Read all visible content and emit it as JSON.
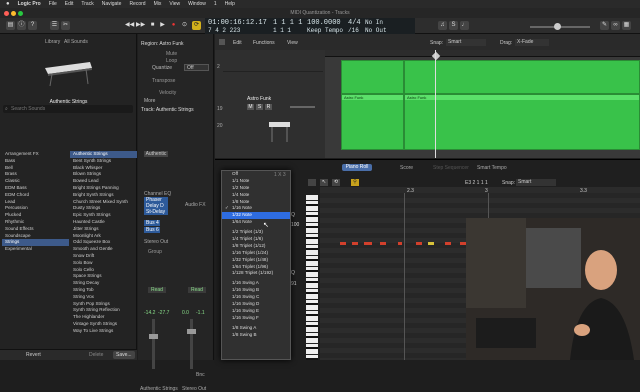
{
  "menubar": {
    "app": "Logic Pro",
    "items": [
      "File",
      "Edit",
      "Track",
      "Navigate",
      "Record",
      "Mix",
      "View",
      "Window",
      "1",
      "Help"
    ]
  },
  "window": {
    "title": "MIDI Quantization - Tracks"
  },
  "lcd": {
    "time": "01:00:16:12.17",
    "time_sub": "7 4 2 223",
    "bars": "1  1  1  1",
    "bars_sub": "1  1  1",
    "tempo": "100.0000",
    "tempo_sub": "Keep Tempo",
    "sig": "4/4",
    "sig_sub": "/16",
    "in": "No In",
    "out": "No Out"
  },
  "library": {
    "title": "Library",
    "presets": "All Sounds",
    "patch": "Authentic Strings",
    "search_placeholder": "Search Sounds",
    "categories": [
      "Arrangement FX",
      "Bass",
      "Bell",
      "Brass",
      "Classic",
      "EDM Bass",
      "EDM Chord",
      "Lead",
      "Percussion",
      "Plucked",
      "Rhythmic",
      "Sound Effects",
      "Soundscape",
      "Strings",
      "Experimental"
    ],
    "patches": [
      "Authentic Strings",
      "Bent Synth Strings",
      "Black Whisper",
      "Blown Strings",
      "Bowed Lead",
      "Bright Strings Panning",
      "Bright Synth Strings",
      "Church Street Mixed Synth",
      "Dusty Strings",
      "Epic Synth Strings",
      "Haunted Castle",
      "Jitter Strings",
      "Moonlight Ark",
      "Odd Squeeze Box",
      "Smooth and Gentle",
      "Snow Drift",
      "Solo Bow",
      "Solo Cello",
      "Space Strings",
      "String Decay",
      "String Tob",
      "String Vox",
      "Synth Pop Strings",
      "Synth String Reflection",
      "The Highlander",
      "Vintage Synth Strings",
      "Way To Live Strings"
    ],
    "revert": "Revert",
    "delete": "Delete",
    "save": "Save..."
  },
  "inspector": {
    "region": "Region: Astro Funk",
    "mute": "Mute",
    "loop": "Loop",
    "quantize": "Quantize",
    "quantize_val": "Off",
    "transpose": "Transpose",
    "velocity": "Velocity",
    "more": "More",
    "track": "Track: Authentic Strings",
    "ch1": "Authentic",
    "eq": "Channel EQ",
    "plugins": [
      "Phaser",
      "Delay D",
      "St-Delay"
    ],
    "bus1": "Bus 4",
    "bus2": "Bus 6",
    "audiofx": "Audio FX",
    "stereo": "Stereo Out",
    "group": "Group",
    "read": "Read",
    "vol1": "-14.2",
    "vol2": "-27.7",
    "vol3": "0.0",
    "vol4": "-1.1",
    "bnc": "Bnc",
    "name1": "Authentic Strings",
    "name2": "Stereo Out"
  },
  "tracks_header": {
    "edit": "Edit",
    "functions": "Functions",
    "view": "View",
    "snap_label": "Snap:",
    "snap": "Smart",
    "drag_label": "Drag:",
    "drag": "X-Fade"
  },
  "track_rows": [
    {
      "num": "2",
      "name": ""
    },
    {
      "num": "19",
      "name": "Astro Funk"
    },
    {
      "num": "20",
      "name": ""
    }
  ],
  "regions": [
    "Astro Funk",
    "Astro Funk"
  ],
  "pianoroll": {
    "tabs": [
      "Piano Roll",
      "Score",
      "Step Sequencer",
      "Smart Tempo"
    ],
    "snap_label": "Snap:",
    "snap": "Smart",
    "region": "Astro Funk",
    "pos": "E3  2 1 1 1",
    "ruler": [
      "2",
      "2.3",
      "3",
      "3.3"
    ],
    "side_values": [
      "Q",
      "100",
      "Q",
      "91"
    ],
    "octave": "C3"
  },
  "quantize_menu": {
    "items": [
      "Off",
      "1/1 Note",
      "1/2 Note",
      "1/4 Note",
      "1/8 Note",
      "1/16 Note",
      "1/32 Note",
      "1/64 Note",
      "",
      "1/2 Triplet (1/3)",
      "1/4 Triplet (1/6)",
      "1/8 Triplet (1/12)",
      "1/16 Triplet (1/24)",
      "1/32 Triplet (1/48)",
      "1/64 Triplet (1/96)",
      "1/128 Triplet (1/192)",
      "",
      "1/16 Swing A",
      "1/16 Swing B",
      "1/16 Swing C",
      "1/16 Swing D",
      "1/16 Swing E",
      "1/16 Swing F",
      "",
      "1/8 Swing A",
      "1/8 Swing B"
    ],
    "checked": "1/16 Note",
    "highlight": "1/32 Note",
    "badge": "1 X 3"
  },
  "colors": {
    "accent": "#2e6ce0",
    "region": "#39c24a",
    "note": "#d2402c"
  }
}
